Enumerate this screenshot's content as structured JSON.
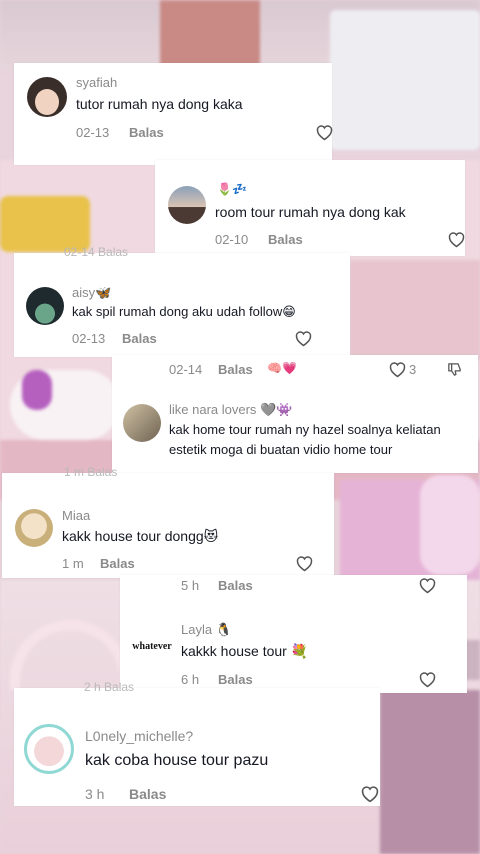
{
  "colors": {
    "text_primary": "#161823",
    "text_secondary": "#8a8a8a",
    "like_red": "#fe2c55"
  },
  "comments": [
    {
      "username": "syafiah",
      "text": "tutor rumah nya dong kaka",
      "time": "02-13",
      "reply": "Balas"
    },
    {
      "username": "",
      "name_emoji": "🌷💤",
      "text": "room tour rumah nya dong kak",
      "time": "02-10",
      "reply": "Balas"
    },
    {
      "username": "aisy🦋",
      "text": "kak spil rumah dong aku udah follow😁",
      "time": "02-13",
      "reply": "Balas"
    },
    {
      "username": "like nara lovers 🩶👾",
      "text_line1": "kak home tour rumah ny hazel soalnya keliatan",
      "text_line2": "estetik moga di buatan vidio home tour",
      "time": "02-14",
      "reply": "Balas",
      "likes": "3",
      "reaction_emoji": "🧠💗"
    },
    {
      "username": "Miaa",
      "text": "kakk house tour dongg😻",
      "time": "1 m",
      "reply": "Balas"
    },
    {
      "username": "Layla 🐧",
      "text": "kakkk house tour 💐",
      "time": "6 h",
      "reply": "Balas",
      "avatar_text": "whatever",
      "above_time": "5 h",
      "above_reply": "Balas"
    },
    {
      "username": "L0nely_michelle?",
      "text": "kak coba house tour pazu",
      "time": "3 h",
      "reply": "Balas"
    }
  ],
  "ghost": {
    "g1": "02-14  Balas",
    "g2": "1 m  Balas",
    "g3": "2 h  Balas"
  }
}
